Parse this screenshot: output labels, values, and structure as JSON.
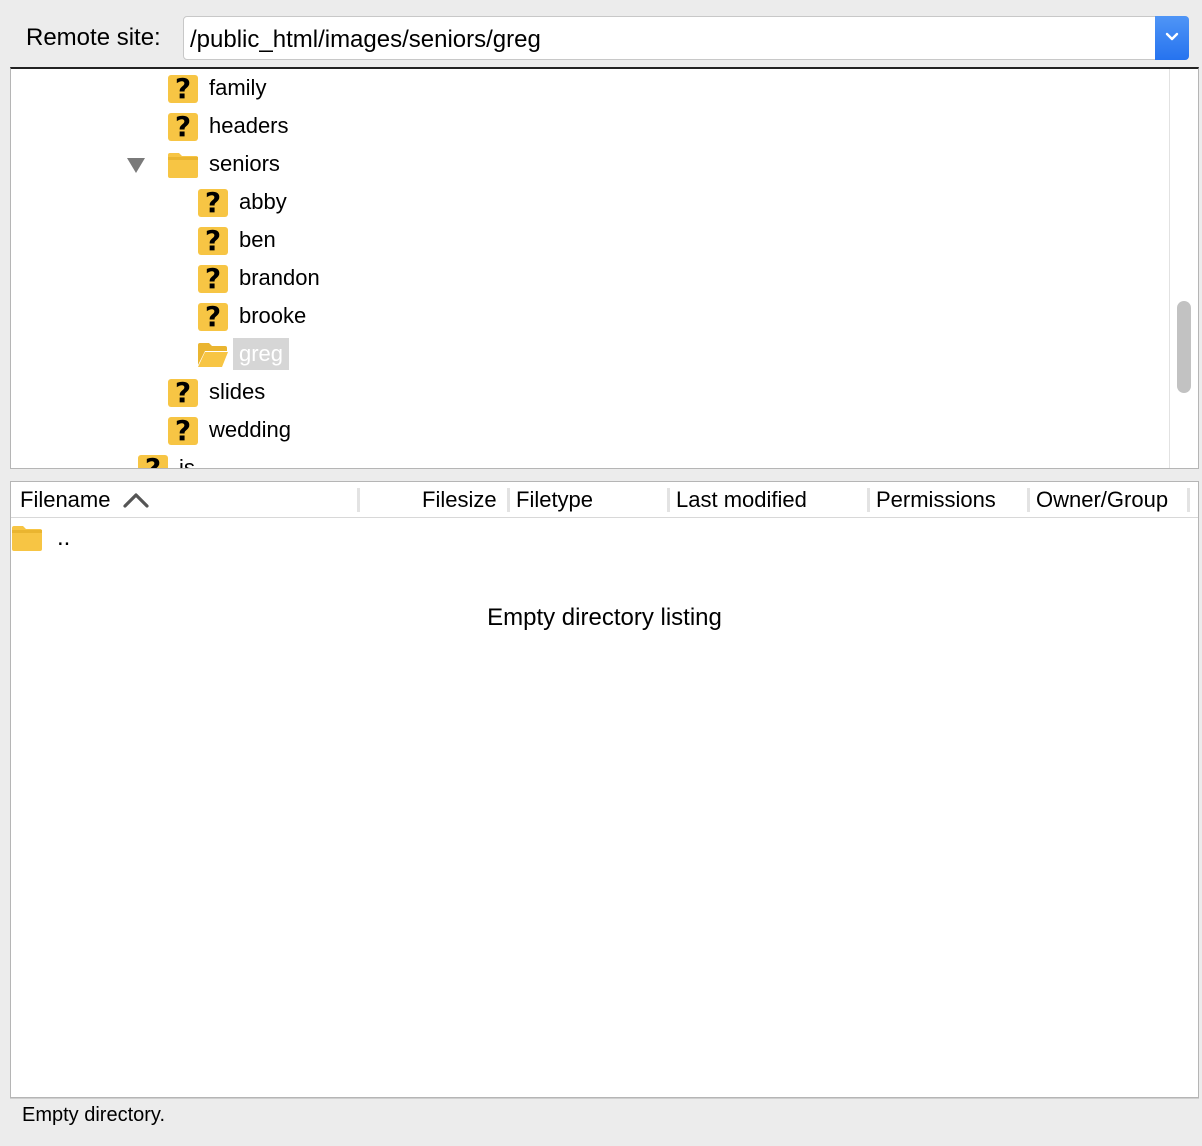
{
  "remote_site": {
    "label": "Remote site:",
    "path": "/public_html/images/seniors/greg"
  },
  "tree": {
    "items": [
      {
        "label": "family",
        "icon": "unknown-folder-icon"
      },
      {
        "label": "headers",
        "icon": "unknown-folder-icon"
      },
      {
        "label": "seniors",
        "icon": "folder-icon",
        "expanded": true
      },
      {
        "label": "abby",
        "icon": "unknown-folder-icon"
      },
      {
        "label": "ben",
        "icon": "unknown-folder-icon"
      },
      {
        "label": "brandon",
        "icon": "unknown-folder-icon"
      },
      {
        "label": "brooke",
        "icon": "unknown-folder-icon"
      },
      {
        "label": "greg",
        "icon": "open-folder-icon",
        "selected": true
      },
      {
        "label": "slides",
        "icon": "unknown-folder-icon"
      },
      {
        "label": "wedding",
        "icon": "unknown-folder-icon"
      },
      {
        "label": "js",
        "icon": "unknown-folder-icon"
      }
    ]
  },
  "file_list": {
    "columns": [
      "Filename",
      "Filesize",
      "Filetype",
      "Last modified",
      "Permissions",
      "Owner/Group"
    ],
    "sort_column": "Filename",
    "sort_direction": "ascending",
    "rows": [
      {
        "name": ".."
      }
    ],
    "empty_message": "Empty directory listing"
  },
  "status_bar": {
    "text": "Empty directory."
  },
  "colors": {
    "folder": "#f7c544",
    "folder_dark": "#eab530",
    "accent": "#2673ef",
    "selection": "#d6d6d6"
  }
}
